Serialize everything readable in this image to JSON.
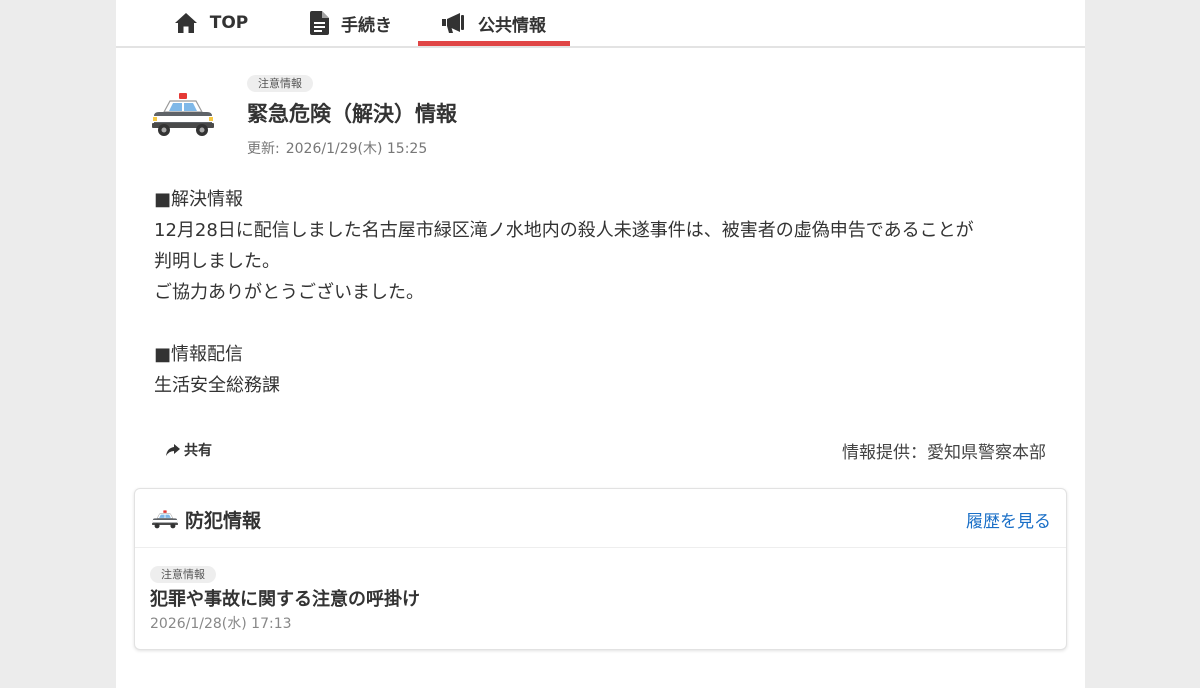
{
  "nav": {
    "tabs": [
      {
        "label": "TOP",
        "icon": "home-icon"
      },
      {
        "label": "手続き",
        "icon": "document-icon"
      },
      {
        "label": "公共情報",
        "icon": "megaphone-icon",
        "active": true
      }
    ],
    "active_color": "#e04545"
  },
  "article": {
    "icon": "police-car-icon",
    "badge": "注意情報",
    "title": "緊急危険（解決）情報",
    "updated_label": "更新:",
    "updated_value": "2026/1/29(木) 15:25",
    "body": {
      "line1": "■解決情報",
      "line2": "12月28日に配信しました名古屋市緑区滝ノ水地内の殺人未遂事件は、被害者の虚偽申告であることが",
      "line3": "判明しました。",
      "line4": "ご協力ありがとうございました。",
      "line5": "■情報配信",
      "line6": "生活安全総務課"
    },
    "share_label": "共有",
    "provider": "情報提供：愛知県警察本部"
  },
  "crime_card": {
    "icon": "police-car-icon",
    "title": "防犯情報",
    "history_link": "履歴を見る",
    "link_color": "#1a6fc7",
    "item": {
      "badge": "注意情報",
      "title": "犯罪や事故に関する注意の呼掛け",
      "date": "2026/1/28(水) 17:13"
    }
  }
}
